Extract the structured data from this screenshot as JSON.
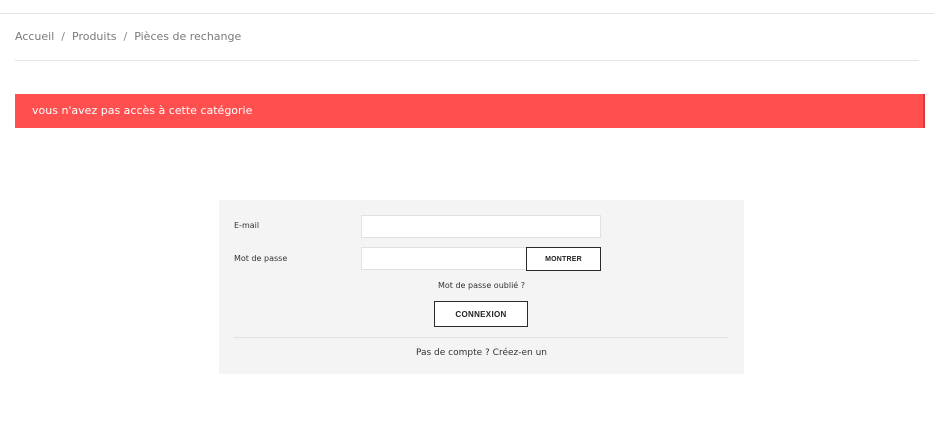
{
  "breadcrumb": {
    "items": [
      {
        "label": "Accueil"
      },
      {
        "label": "Produits"
      },
      {
        "label": "Pièces de rechange"
      }
    ],
    "separator": "/"
  },
  "alert": {
    "message": "vous n'avez pas accès à cette catégorie",
    "color": "#ff4f4f"
  },
  "login": {
    "email_label": "E-mail",
    "email_value": "",
    "password_label": "Mot de passe",
    "password_value": "",
    "show_button": "MONTRER",
    "forgot_link": "Mot de passe oublié ?",
    "submit_button": "CONNEXION",
    "create_account_link": "Pas de compte ? Créez-en un"
  }
}
